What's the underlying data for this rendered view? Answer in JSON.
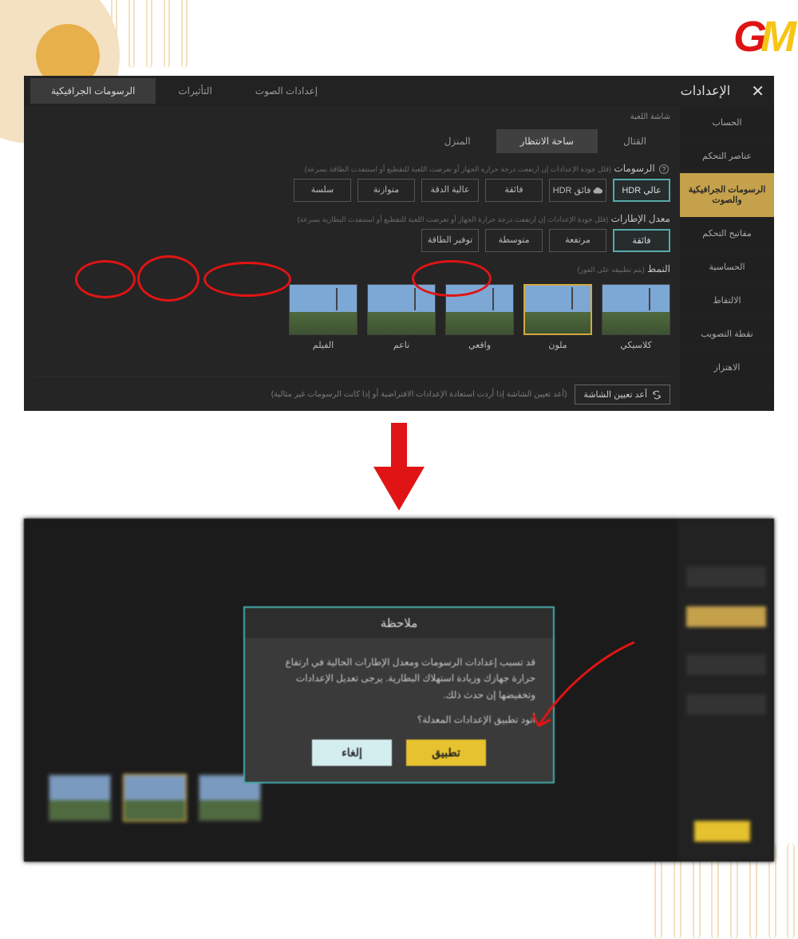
{
  "logo": {
    "g": "G",
    "m": "M"
  },
  "top": {
    "header": {
      "title": "الإعدادات",
      "tabs": [
        "الرسومات الجرافيكية",
        "التأثيرات",
        "إعدادات الصوت"
      ],
      "active_tab": 0
    },
    "sidebar": {
      "items": [
        "الحساب",
        "عناصر التحكم",
        "الرسومات الجرافيكية والصوت",
        "مفاتيح التحكم",
        "الحساسية",
        "الالتقاط",
        "نقطة التصويب",
        "الاهتزاز"
      ],
      "active_index": 2
    },
    "sub_label": "شاشة اللعبة",
    "sub_tabs": [
      "القتال",
      "ساحة الانتظار",
      "المنزل"
    ],
    "sub_active": 1,
    "graphics": {
      "label": "الرسومات",
      "hint": "(قلل جودة الإعدادات إن ارتفعت درجة حرارة الجهاز أو تعرضت اللعبة للتقطيع أو استنفدت الطاقة بسرعة)",
      "options": [
        "سلسة",
        "متوازنة",
        "عالية الدقة",
        "فائقة",
        "فائق HDR",
        "عالي HDR"
      ],
      "selected": 5
    },
    "fps": {
      "label": "معدل الإطارات",
      "hint": "(قلل جودة الإعدادات إن ارتفعت درجة حرارة الجهاز أو تعرضت اللعبة للتقطيع أو استنفدت البطارية بسرعة)",
      "options": [
        "توفير الطاقة",
        "متوسطة",
        "مرتفعة",
        "فائقة"
      ],
      "selected": 3
    },
    "style": {
      "label": "النمط",
      "hint": "(يتم تطبيقه على الفور)",
      "options": [
        "كلاسيكي",
        "ملون",
        "واقعي",
        "ناعم",
        "الفيلم"
      ],
      "selected": 1
    },
    "reset": {
      "button": "أعد تعيين الشاشة",
      "hint": "(أعد تعيين الشاشة إذا أردت استعادة الإعدادات الافتراضية أو إذا كانت الرسومات غير مثالية)"
    }
  },
  "modal": {
    "title": "ملاحظة",
    "body": "قد تسبب إعدادات الرسومات ومعدل الإطارات الحالية في ارتفاع حرارة جهازك وزيادة استهلاك البطارية. يرجى تعديل الإعدادات وتخفيضها إن حدث ذلك.",
    "question": "أتود تطبيق الإعدادات المعدلة؟",
    "apply": "تطبيق",
    "cancel": "إلغاء"
  }
}
